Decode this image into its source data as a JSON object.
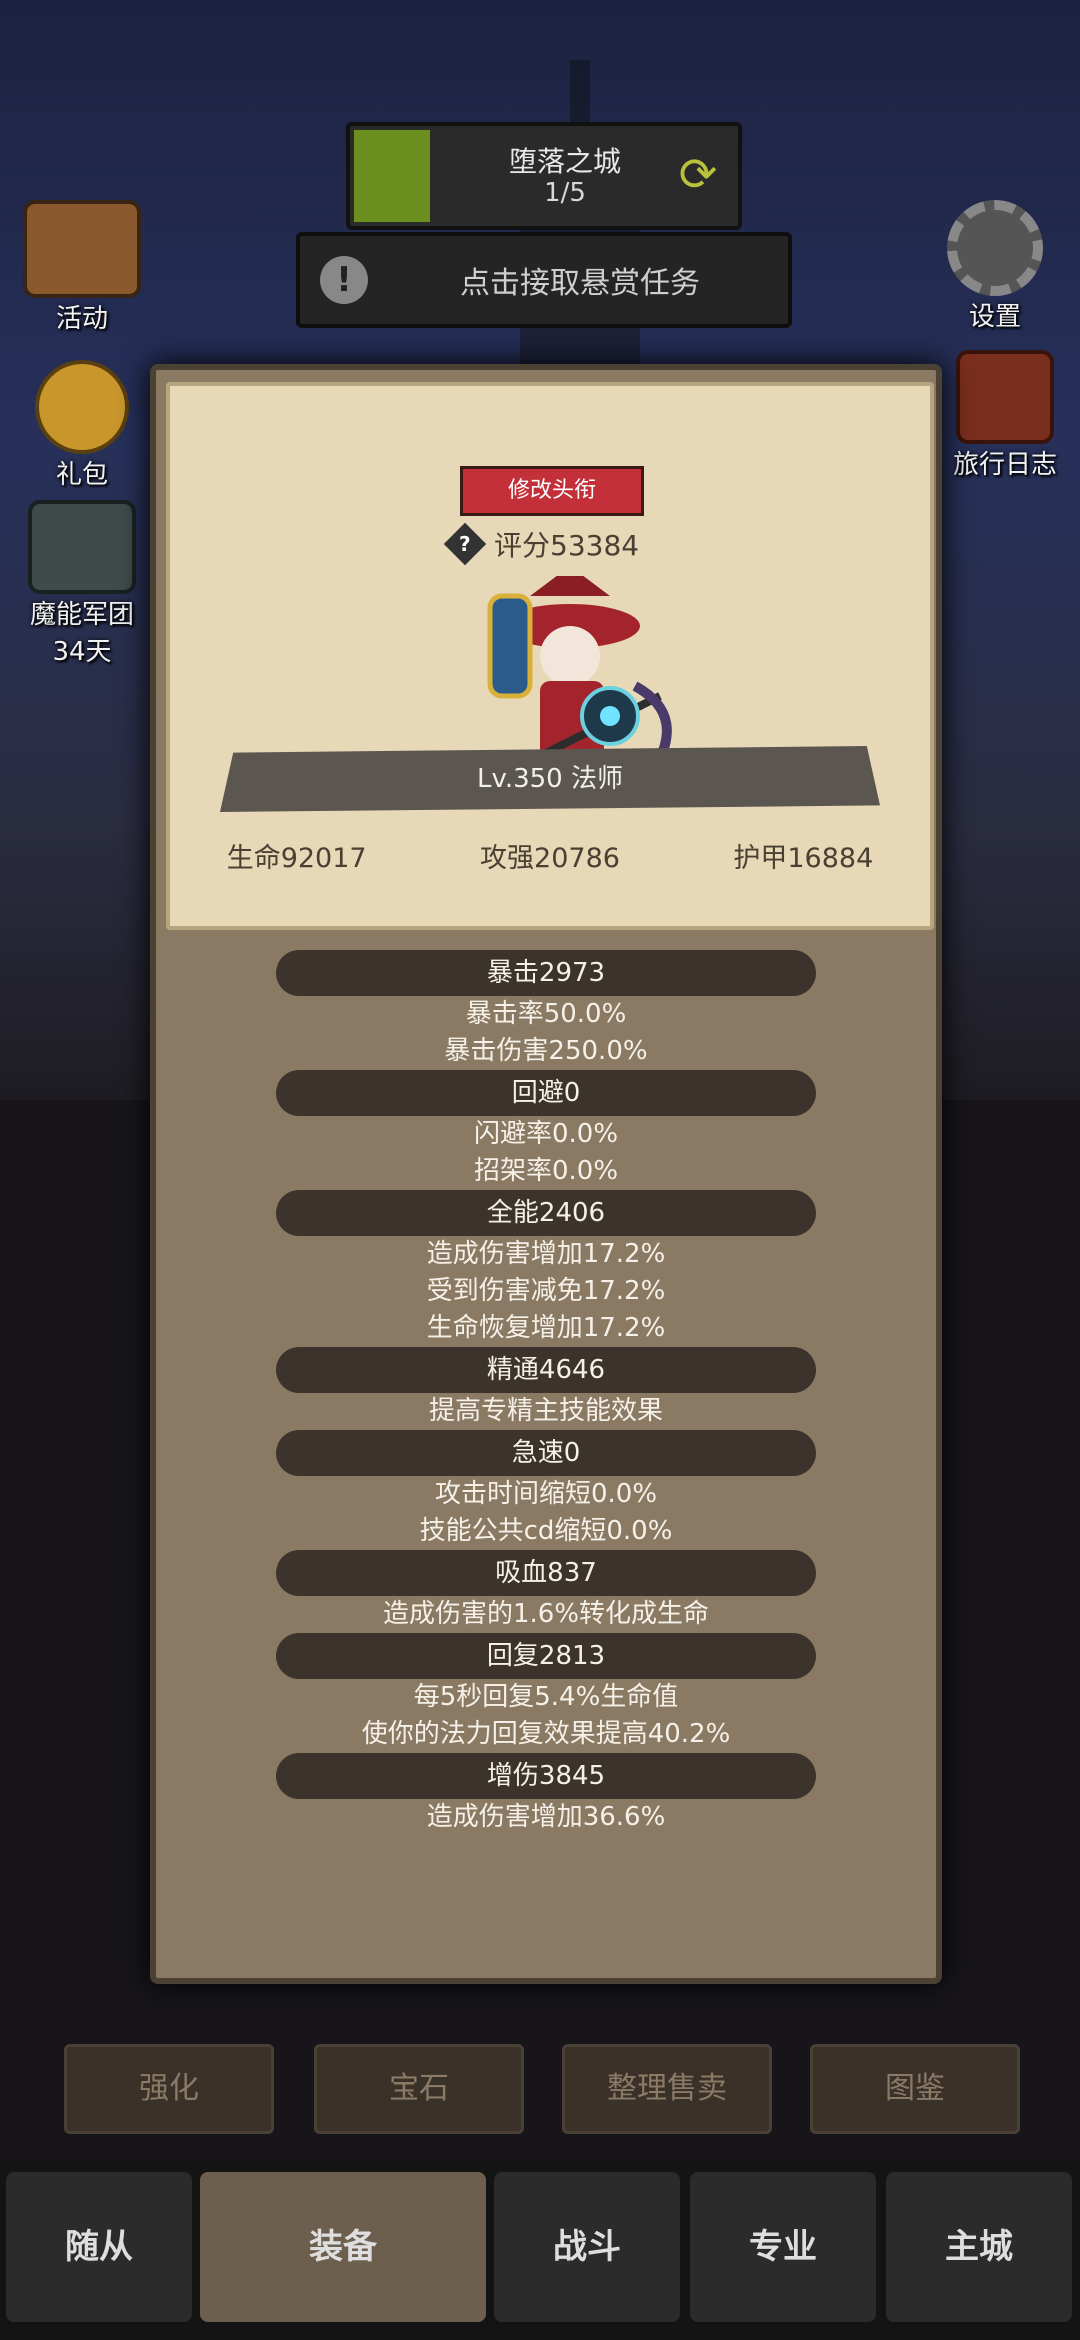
{
  "quest": {
    "name": "堕落之城",
    "progress": "1/5",
    "progress_fraction": 0.2
  },
  "bounty": {
    "label": "点击接取悬赏任务"
  },
  "side_left": [
    {
      "label": "活动",
      "icon": "activity-icon"
    },
    {
      "label": "礼包",
      "icon": "gift-icon"
    },
    {
      "label": "魔能军团",
      "sub": "34天",
      "icon": "legion-icon"
    }
  ],
  "side_right": [
    {
      "label": "设置",
      "icon": "gear-icon"
    },
    {
      "label": "旅行日志",
      "icon": "journal-icon"
    }
  ],
  "panel": {
    "title_button": "修改头衔",
    "rating": "评分53384",
    "level_class": "Lv.350 法师",
    "base_stats": [
      "生命92017",
      "攻强20786",
      "护甲16884"
    ],
    "stats": [
      {
        "header": "暴击2973",
        "lines": [
          "暴击率50.0%",
          "暴击伤害250.0%"
        ]
      },
      {
        "header": "回避0",
        "lines": [
          "闪避率0.0%",
          "招架率0.0%"
        ]
      },
      {
        "header": "全能2406",
        "lines": [
          "造成伤害增加17.2%",
          "受到伤害减免17.2%",
          "生命恢复增加17.2%"
        ]
      },
      {
        "header": "精通4646",
        "lines": [
          "提高专精主技能效果"
        ]
      },
      {
        "header": "急速0",
        "lines": [
          "攻击时间缩短0.0%",
          "技能公共cd缩短0.0%"
        ]
      },
      {
        "header": "吸血837",
        "lines": [
          "造成伤害的1.6%转化成生命"
        ]
      },
      {
        "header": "回复2813",
        "lines": [
          "每5秒回复5.4%生命值",
          "使你的法力回复效果提高40.2%"
        ]
      },
      {
        "header": "增伤3845",
        "lines": [
          "造成伤害增加36.6%"
        ]
      }
    ]
  },
  "functions": [
    "强化",
    "宝石",
    "整理售卖",
    "图鉴"
  ],
  "nav": [
    "随从",
    "装备",
    "战斗",
    "专业",
    "主城"
  ],
  "colors": {
    "panel": "#8a7a64",
    "parchment": "#e7d8b7",
    "title_button": "#c4303a",
    "quest_progress": "#6a8f1e"
  }
}
